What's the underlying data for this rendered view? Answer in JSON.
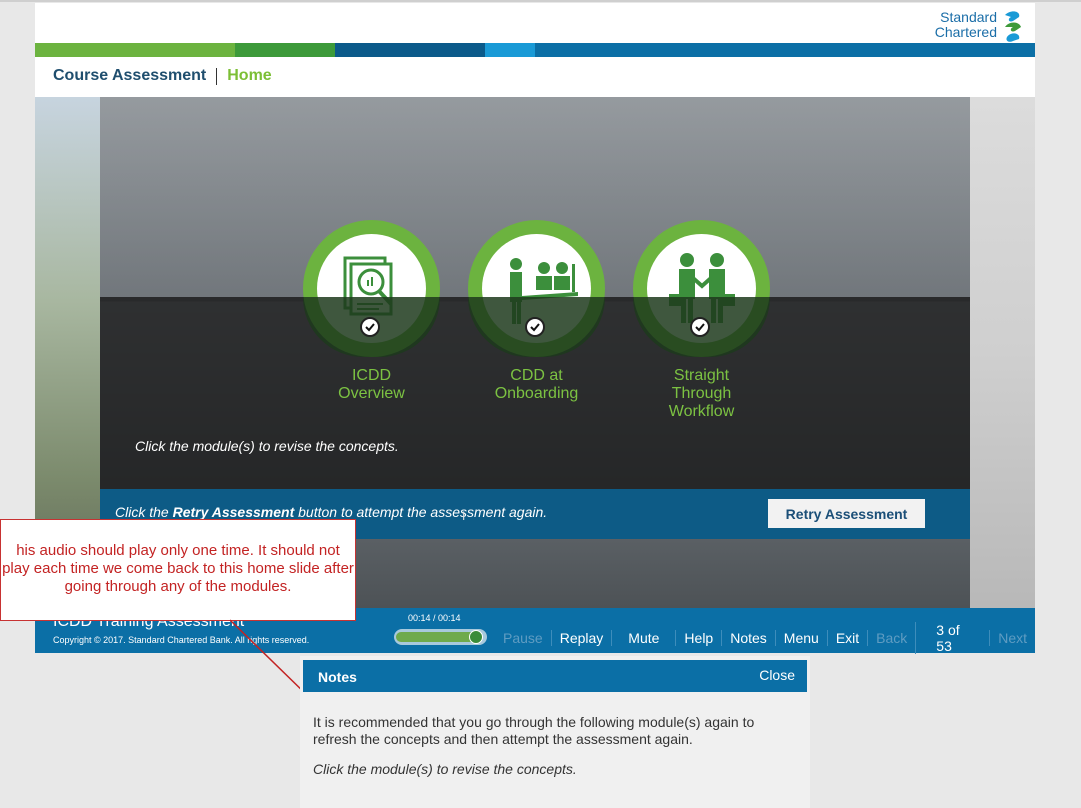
{
  "brand": {
    "line1": "Standard",
    "line2": "Chartered",
    "logo_icon": "standard-chartered-logo",
    "colors": [
      "#6cb33f",
      "#3d9a3a",
      "#0b5a8a",
      "#1a9ad6",
      "#0b6fa6"
    ]
  },
  "nav": {
    "course": "Course Assessment",
    "home": "Home"
  },
  "modules": [
    {
      "label": "ICDD\nOverview",
      "icon": "document-magnifier-icon",
      "status": "completed"
    },
    {
      "label": "CDD at\nOnboarding",
      "icon": "onboarding-desk-icon",
      "status": "completed"
    },
    {
      "label": "Straight\nThrough\nWorkflow",
      "icon": "handshake-icon",
      "status": "completed"
    }
  ],
  "hint": "Click the module(s) to revise the concepts.",
  "retry": {
    "pre": "Click the ",
    "bold": "Retry Assessment",
    "post": " button to attempt the assessment again.",
    "button": "Retry Assessment"
  },
  "callout": "his audio should play only one time. It should not play each time we come back to this home slide after going through any of the modules.",
  "footer": {
    "title": "ICDD Training Assessment",
    "copyright": "Copyright © 2017. Standard Chartered Bank. All rights reserved.",
    "time": "00:14 / 00:14",
    "progress": 1.0,
    "controls": [
      {
        "label": "Pause",
        "enabled": false
      },
      {
        "label": "Replay",
        "enabled": true
      },
      {
        "label": "Mute",
        "enabled": true
      },
      {
        "label": "Help",
        "enabled": true
      },
      {
        "label": "Notes",
        "enabled": true
      },
      {
        "label": "Menu",
        "enabled": true
      },
      {
        "label": "Exit",
        "enabled": true
      },
      {
        "label": "Back",
        "enabled": false
      },
      {
        "label": "3 of 53",
        "enabled": true
      },
      {
        "label": "Next",
        "enabled": false
      }
    ]
  },
  "notes": {
    "title": "Notes",
    "close": "Close",
    "line1": "It is recommended that you go through the following module(s) again to refresh the concepts and then attempt the assessment again.",
    "line2": "Click the module(s) to revise the concepts."
  }
}
